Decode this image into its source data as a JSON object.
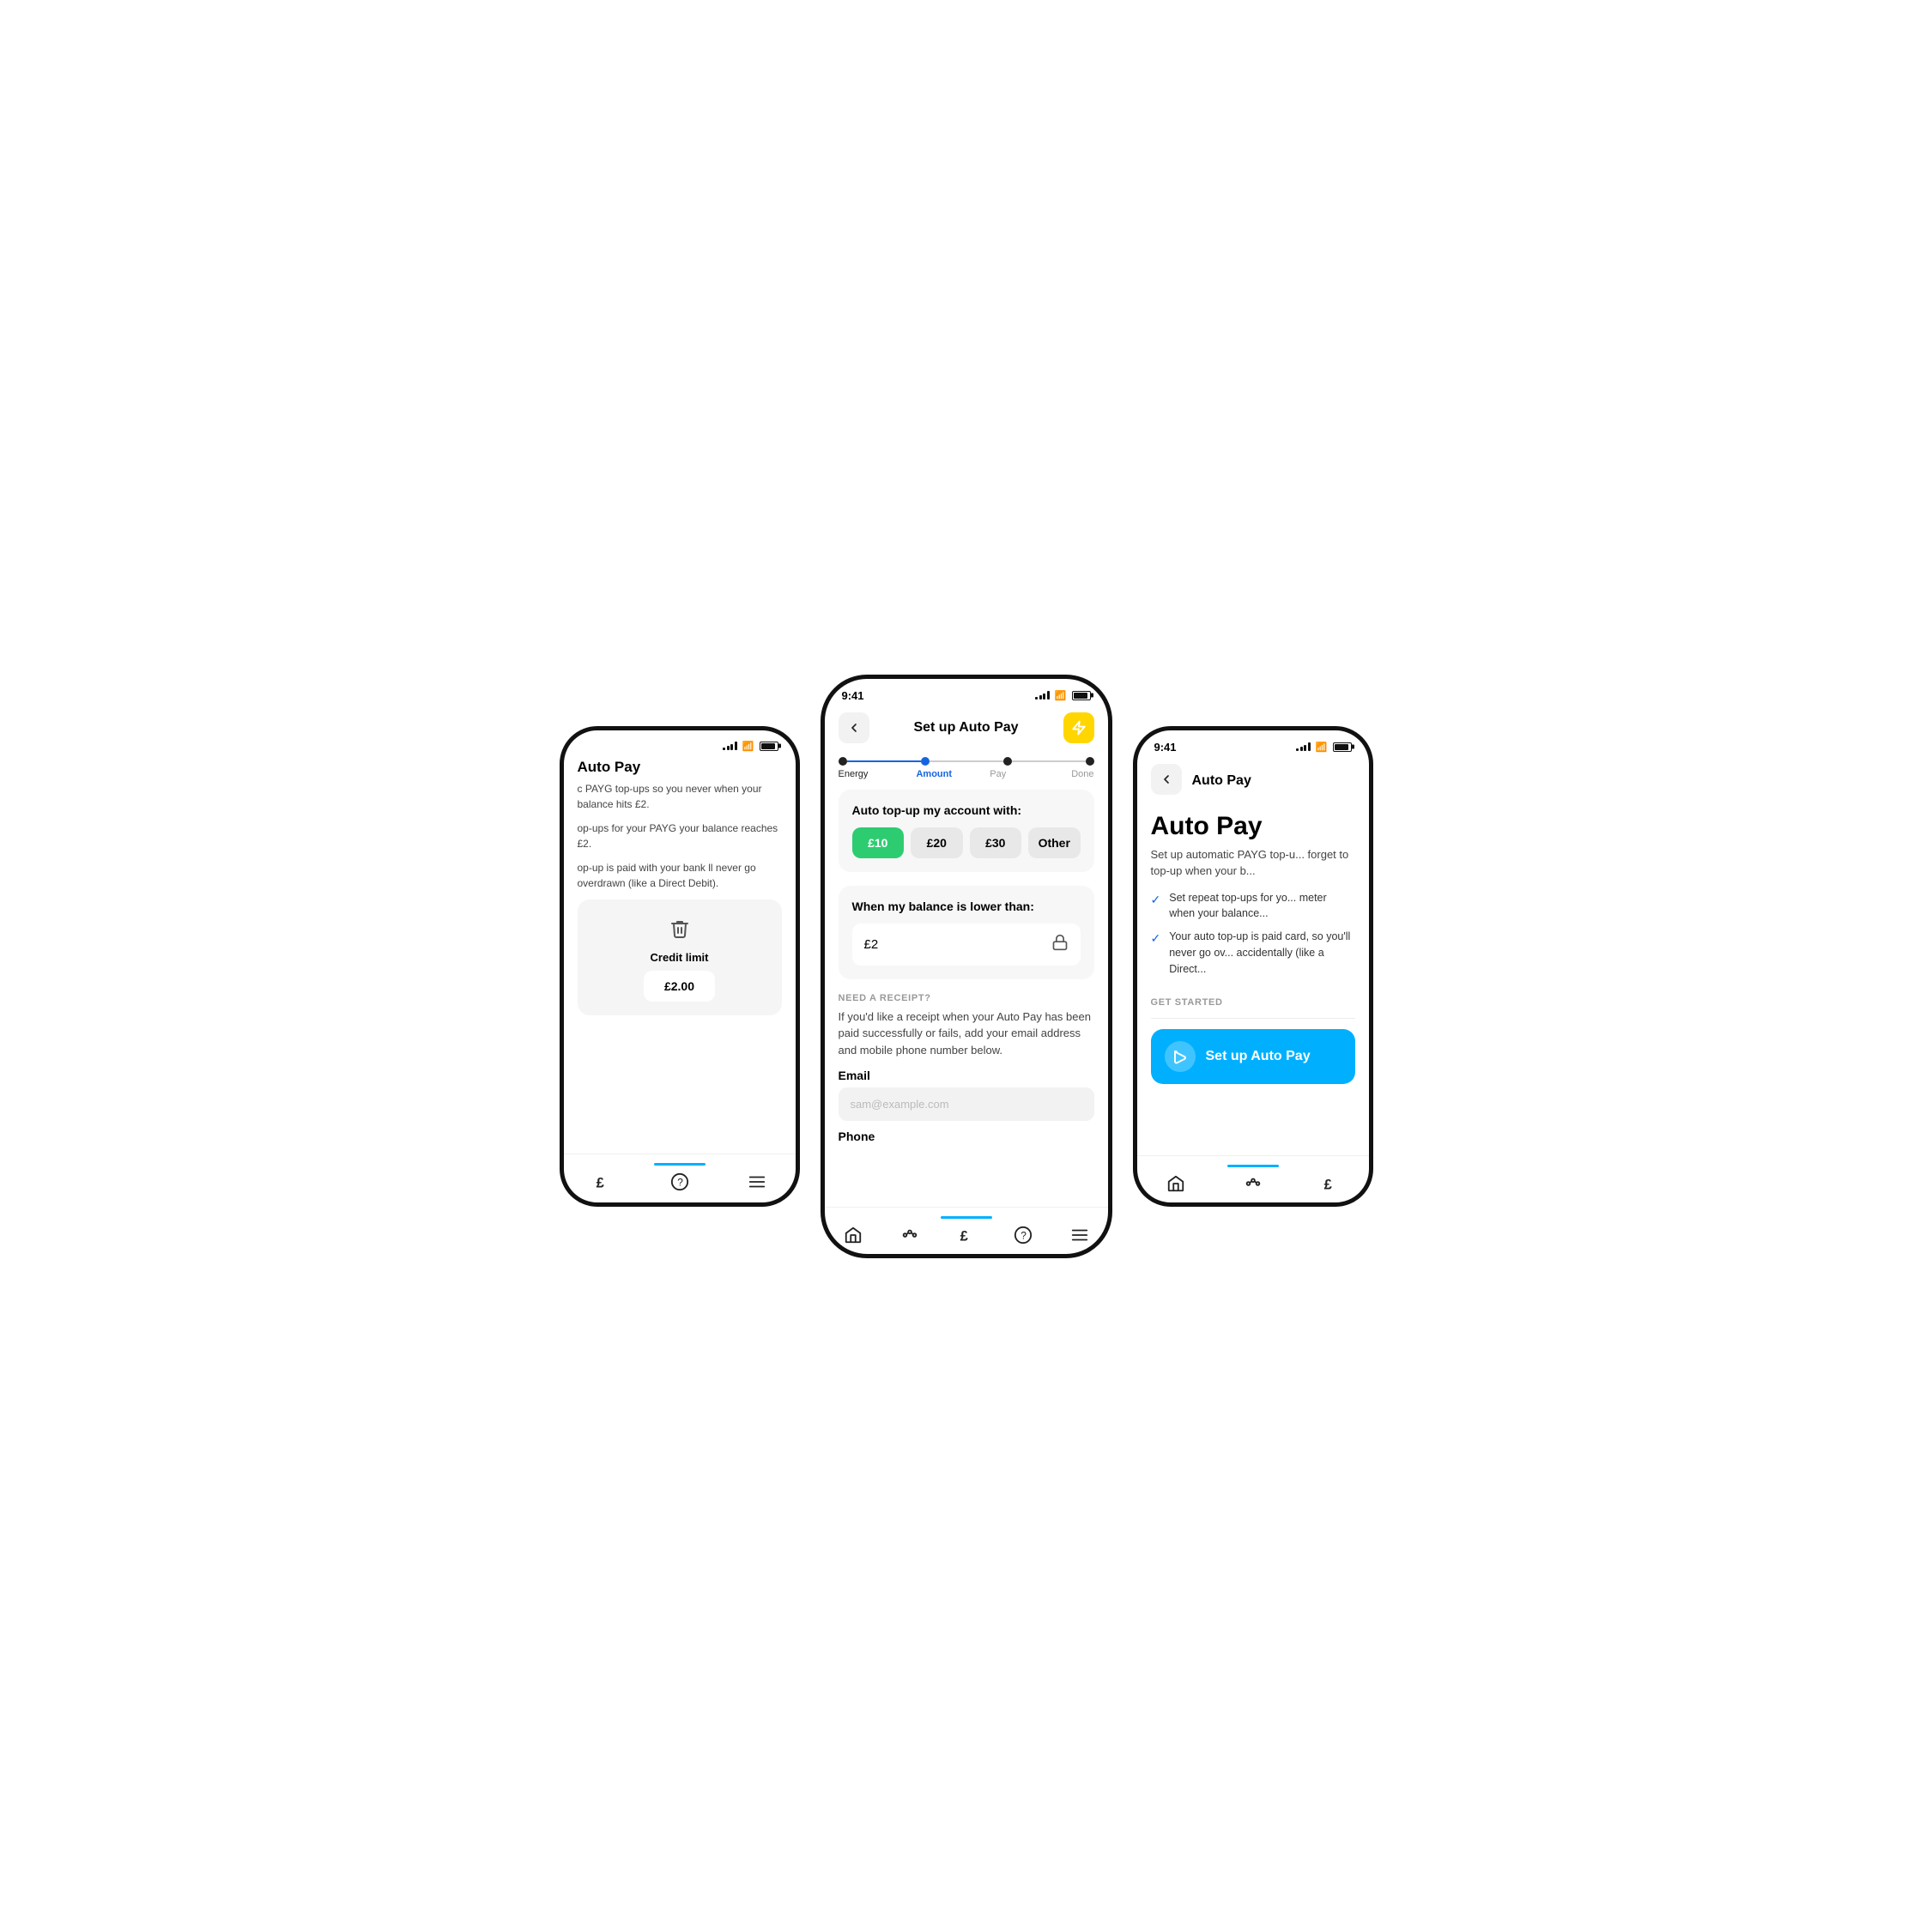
{
  "left_phone": {
    "status_time": "",
    "title": "Auto Pay",
    "description1": "c PAYG top-ups so you never when your balance hits £2.",
    "description2": "op-ups for your PAYG your balance reaches £2.",
    "description3": "op-up is paid with your bank ll never go overdrawn (like a Direct Debit).",
    "credit_limit_label": "Credit limit",
    "credit_amount": "£2.00",
    "nav_items": [
      "£",
      "?",
      "☰"
    ]
  },
  "center_phone": {
    "status_time": "9:41",
    "title": "Set up Auto Pay",
    "back_label": "←",
    "steps": [
      {
        "label": "Energy",
        "state": "done"
      },
      {
        "label": "Amount",
        "state": "active"
      },
      {
        "label": "Pay",
        "state": "inactive"
      },
      {
        "label": "Done",
        "state": "inactive"
      }
    ],
    "topup_card": {
      "title": "Auto top-up my account with:",
      "options": [
        {
          "label": "£10",
          "selected": true
        },
        {
          "label": "£20",
          "selected": false
        },
        {
          "label": "£30",
          "selected": false
        },
        {
          "label": "Other",
          "selected": false
        }
      ]
    },
    "balance_card": {
      "title": "When my balance is lower than:",
      "value": "£2"
    },
    "receipt_section": {
      "heading": "NEED A RECEIPT?",
      "description": "If you'd like a receipt when your Auto Pay has been paid successfully or fails, add your email address and mobile phone number below.",
      "email_label": "Email",
      "email_placeholder": "sam@example.com",
      "phone_label": "Phone"
    }
  },
  "right_phone": {
    "status_time": "9:41",
    "back_label": "←",
    "nav_title": "Auto Pay",
    "page_title": "Auto Pay",
    "page_description": "Set up automatic PAYG top-u... forget to top-up when your b...",
    "check_items": [
      "Set repeat top-ups for yo... meter when your balance...",
      "Your auto top-up is paid card, so you'll never go ov... accidentally (like a Direct..."
    ],
    "get_started_label": "GET STARTED",
    "setup_btn_label": "Set up Auto Pay"
  },
  "icons": {
    "back_arrow": "←",
    "lightning": "⚡",
    "lock": "🔒",
    "delete": "🗑",
    "infinity": "∞",
    "home": "⌂",
    "graph": "∿",
    "pound": "£",
    "question": "?",
    "menu": "☰",
    "checkmark": "✓"
  },
  "colors": {
    "active_step": "#1565E0",
    "selected_amount": "#2ecc71",
    "nav_indicator": "#00B0FF",
    "setup_btn": "#00B0FF",
    "lightning_bg": "#FFD600"
  }
}
